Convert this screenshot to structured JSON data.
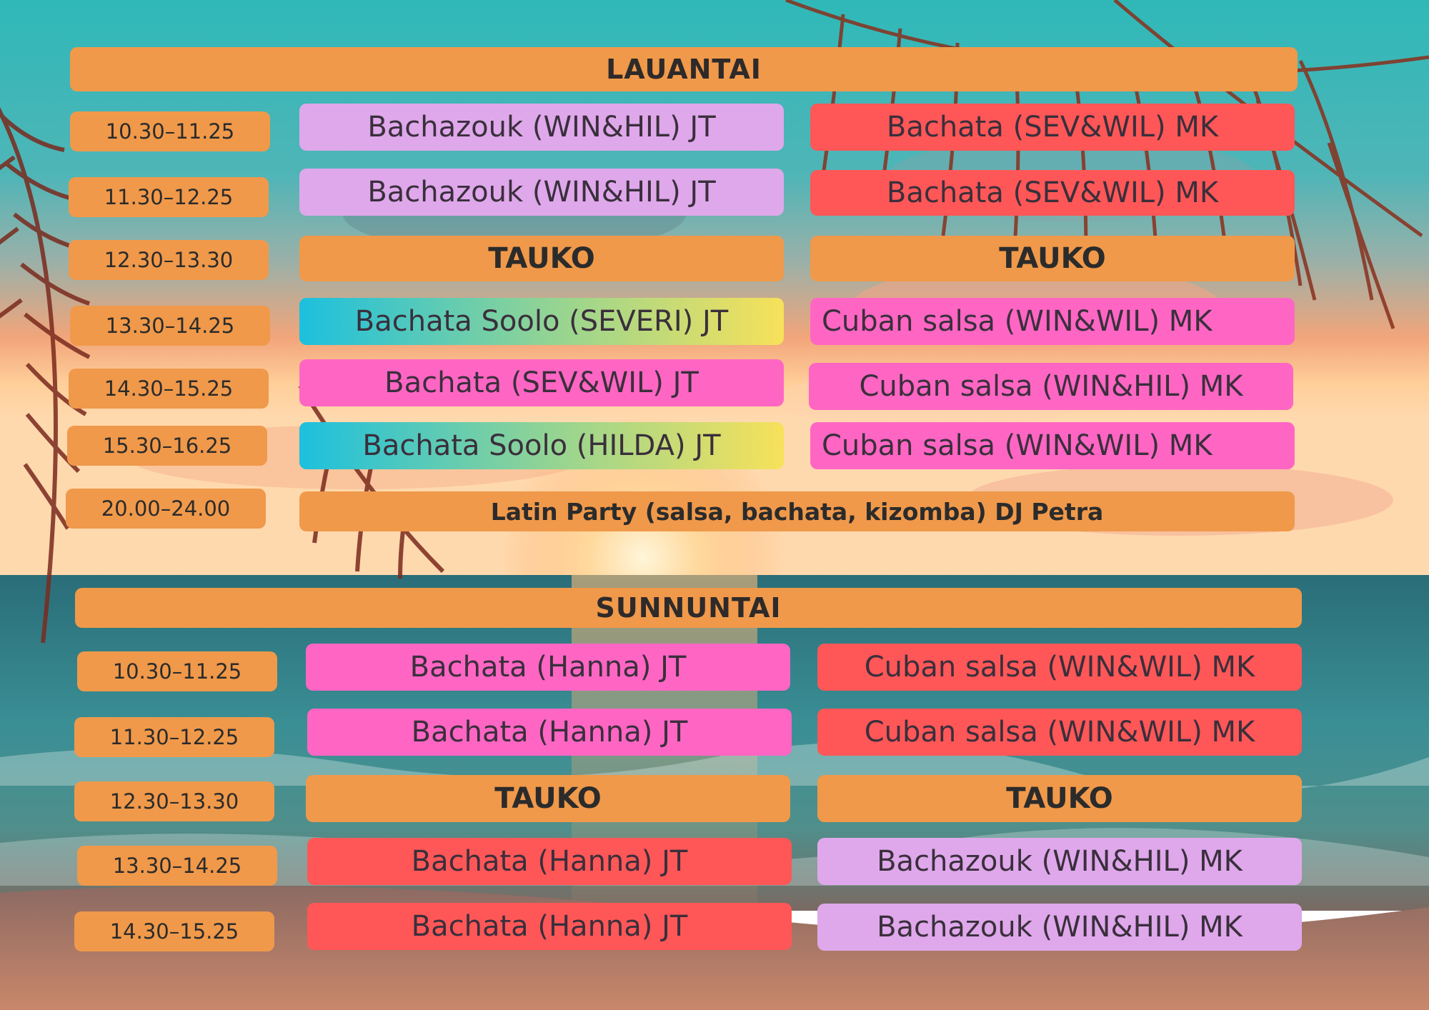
{
  "colors": {
    "orange": "#F0994A",
    "lilac": "#DFA8EB",
    "coral": "#FF5757",
    "pink": "#FF66C4",
    "gradient_start": "#1CC0DE",
    "gradient_end": "#F7E15A"
  },
  "saturday": {
    "title": "LAUANTAI",
    "times": [
      "10.30–11.25",
      "11.30–12.25",
      "12.30–13.30",
      "13.30–14.25",
      "14.30–15.25",
      "15.30–16.25",
      "20.00–24.00"
    ],
    "left": [
      "Bachazouk (WIN&HIL) JT",
      "Bachazouk (WIN&HIL) JT",
      "TAUKO",
      "Bachata Soolo (SEVERI) JT",
      "Bachata (SEV&WIL) JT",
      "Bachata Soolo (HILDA) JT"
    ],
    "right": [
      "Bachata (SEV&WIL) MK",
      "Bachata (SEV&WIL) MK",
      "TAUKO",
      "Cuban salsa (WIN&WIL) MK",
      "Cuban salsa (WIN&HIL) MK",
      "Cuban salsa (WIN&WIL) MK"
    ],
    "party": "Latin Party (salsa, bachata, kizomba) DJ Petra"
  },
  "sunday": {
    "title": "SUNNUNTAI",
    "times": [
      "10.30–11.25",
      "11.30–12.25",
      "12.30–13.30",
      "13.30–14.25",
      "14.30–15.25"
    ],
    "left": [
      "Bachata (Hanna) JT",
      "Bachata (Hanna) JT",
      "TAUKO",
      "Bachata (Hanna) JT",
      "Bachata (Hanna) JT"
    ],
    "right": [
      "Cuban salsa (WIN&WIL) MK",
      "Cuban salsa (WIN&WIL) MK",
      "TAUKO",
      "Bachazouk (WIN&HIL) MK",
      "Bachazouk (WIN&HIL) MK"
    ]
  }
}
